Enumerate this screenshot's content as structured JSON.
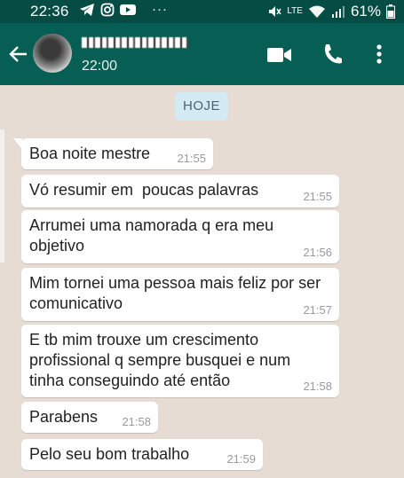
{
  "status_bar": {
    "time": "22:36",
    "battery": "61%",
    "network": "LTE",
    "icons": [
      "telegram-icon",
      "instagram-icon",
      "youtube-icon",
      "more-icon",
      "mute-icon",
      "volte-icon",
      "wifi-icon",
      "signal-icon",
      "battery-icon"
    ]
  },
  "header": {
    "last_seen": "22:00",
    "icons": [
      "back-arrow-icon",
      "video-call-icon",
      "phone-icon",
      "more-vert-icon"
    ]
  },
  "chat": {
    "date_chip": "HOJE",
    "messages": [
      {
        "text": "Boa noite mestre",
        "time": "21:55"
      },
      {
        "text": "Vó resumir em  poucas palavras",
        "time": "21:55"
      },
      {
        "text": "Arrumei uma namorada q era meu objetivo",
        "time": "21:56"
      },
      {
        "text": "Mim tornei uma pessoa mais feliz por ser comunicativo",
        "time": "21:57"
      },
      {
        "text": "E tb mim trouxe um crescimento profissional q sempre busquei e num tinha conseguindo até então",
        "time": "21:58"
      },
      {
        "text": "Parabens",
        "time": "21:58"
      },
      {
        "text": "Pelo seu bom trabalho",
        "time": "21:59"
      }
    ]
  },
  "colors": {
    "header": "#075e54",
    "status_bar": "#054d44",
    "chat_bg": "#e6dcd3",
    "bubble": "#ffffff",
    "date_chip": "#d4eaf4"
  }
}
